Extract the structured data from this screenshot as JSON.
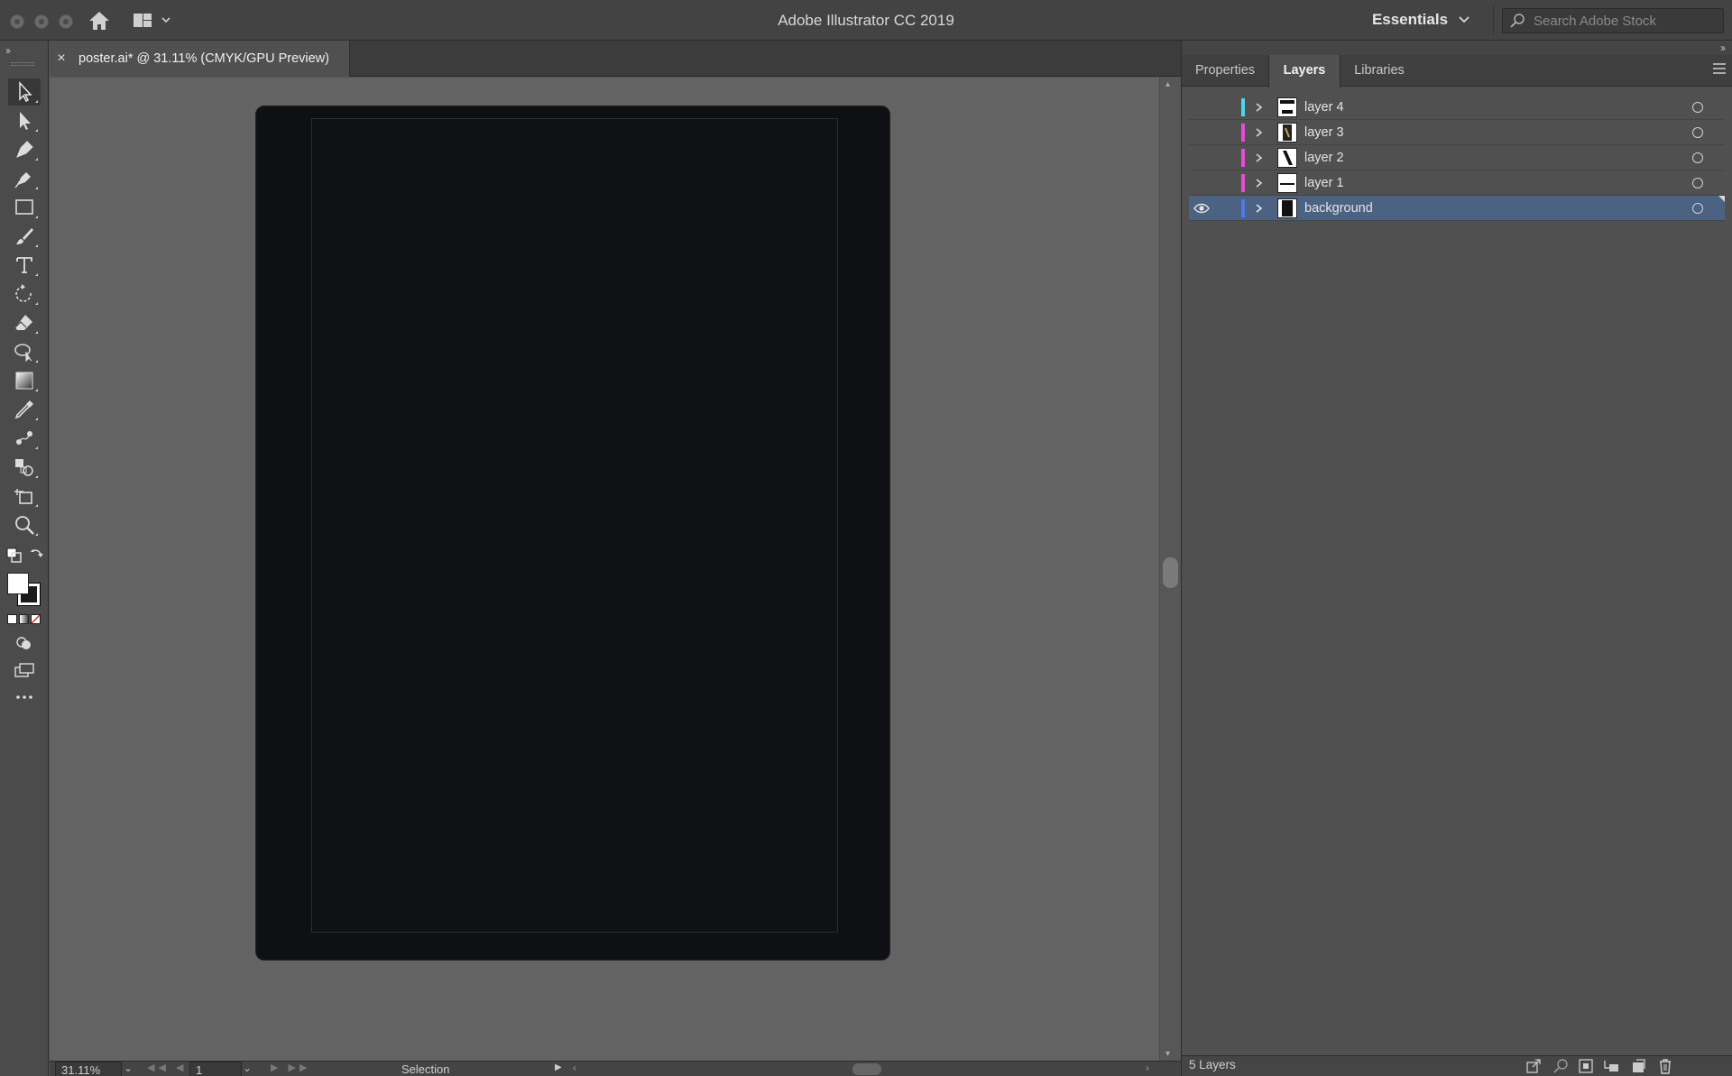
{
  "app": {
    "title": "Adobe Illustrator CC 2019",
    "workspace": "Essentials",
    "search_placeholder": "Search Adobe Stock"
  },
  "document": {
    "tab_label": "poster.ai* @ 31.11% (CMYK/GPU Preview)",
    "close_glyph": "×"
  },
  "status": {
    "zoom": "31.11%",
    "page": "1",
    "tool": "Selection"
  },
  "panel": {
    "tabs": [
      {
        "label": "Properties",
        "active": false
      },
      {
        "label": "Layers",
        "active": true
      },
      {
        "label": "Libraries",
        "active": false
      }
    ],
    "layers": [
      {
        "name": "layer 4",
        "color": "#4fd6e6",
        "visible": false,
        "selected": false
      },
      {
        "name": "layer 3",
        "color": "#e04fd0",
        "visible": false,
        "selected": false
      },
      {
        "name": "layer 2",
        "color": "#e04fd0",
        "visible": false,
        "selected": false
      },
      {
        "name": "layer 1",
        "color": "#e04fd0",
        "visible": false,
        "selected": false
      },
      {
        "name": "background",
        "color": "#4f78e6",
        "visible": true,
        "selected": true
      }
    ],
    "layer_count": "5 Layers"
  },
  "colors": {
    "selection": "#4b6282",
    "canvas": "#636363",
    "artboard": "#0f1013"
  }
}
